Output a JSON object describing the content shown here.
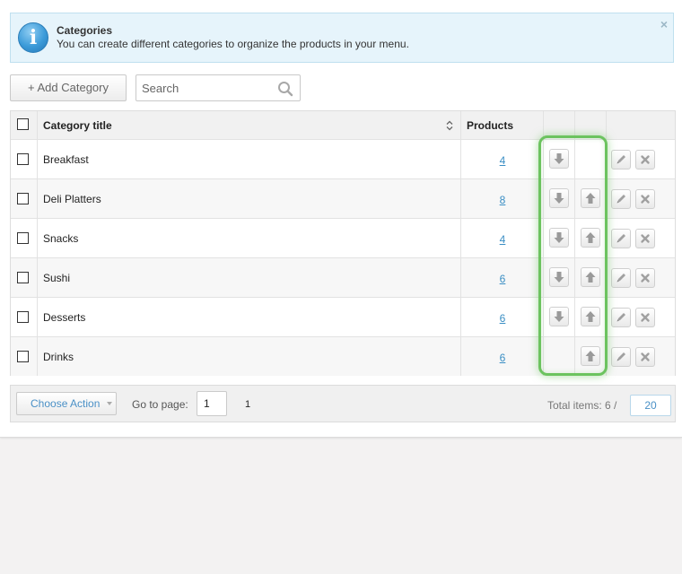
{
  "info": {
    "title": "Categories",
    "text": "You can create different categories to organize the products in your menu.",
    "close": "×"
  },
  "toolbar": {
    "add_label": "+ Add Category",
    "search_placeholder": "Search"
  },
  "table": {
    "headers": {
      "title": "Category title",
      "products": "Products"
    },
    "rows": [
      {
        "title": "Breakfast",
        "products": "4",
        "can_move_down": true,
        "can_move_up": false
      },
      {
        "title": "Deli Platters",
        "products": "8",
        "can_move_down": true,
        "can_move_up": true
      },
      {
        "title": "Snacks",
        "products": "4",
        "can_move_down": true,
        "can_move_up": true
      },
      {
        "title": "Sushi",
        "products": "6",
        "can_move_down": true,
        "can_move_up": true
      },
      {
        "title": "Desserts",
        "products": "6",
        "can_move_down": true,
        "can_move_up": true
      },
      {
        "title": "Drinks",
        "products": "6",
        "can_move_down": false,
        "can_move_up": true
      }
    ]
  },
  "footer": {
    "choose_action": "Choose Action",
    "goto_label": "Go to page:",
    "page_value": "1",
    "page_total": "1",
    "total_label": "Total items: 6 /",
    "per_page": "20"
  },
  "colors": {
    "highlight": "#6cc35f",
    "link": "#3a8ec4",
    "info_bg": "#e6f4fb"
  }
}
